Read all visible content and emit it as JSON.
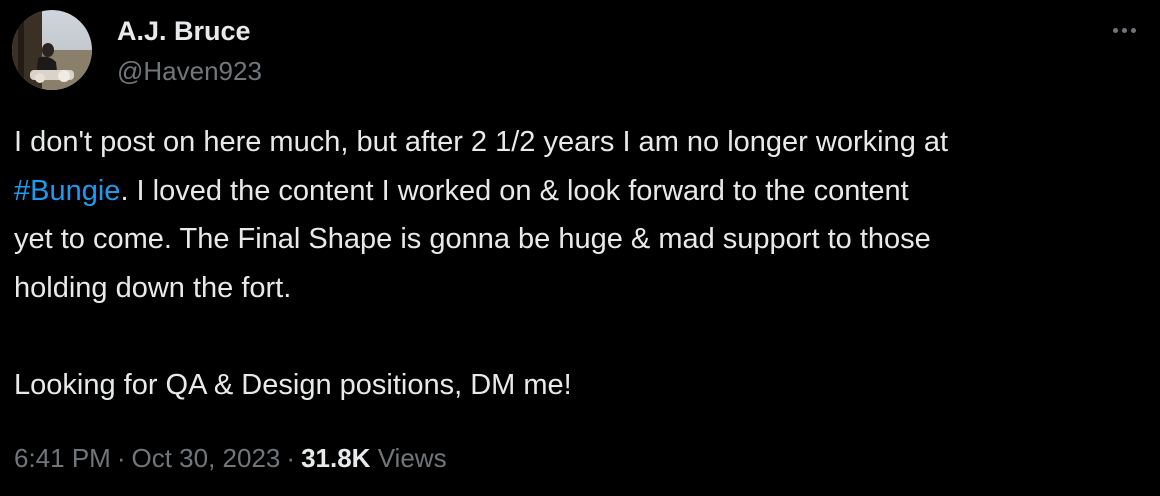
{
  "author": {
    "display_name": "A.J. Bruce",
    "handle": "@Haven923"
  },
  "tweet": {
    "line_1": "I don't post on here much, but after 2 1/2 years I am no longer working at",
    "hashtag": "#Bungie",
    "line_2_rest": ". I loved the content I worked on & look forward to the content",
    "line_3": "yet to come. The Final Shape is gonna be huge & mad support to those",
    "line_4": "holding down the fort.",
    "line_5": "Looking for QA & Design positions, DM me!"
  },
  "meta": {
    "time": "6:41 PM",
    "separator": "·",
    "date": "Oct 30, 2023",
    "views_count": "31.8K",
    "views_label": "Views"
  },
  "colors": {
    "background": "#000000",
    "text": "#e7e9ea",
    "secondary": "#71767b",
    "link": "#1d9bf0"
  },
  "icons": {
    "more": "more-horizontal-icon"
  }
}
